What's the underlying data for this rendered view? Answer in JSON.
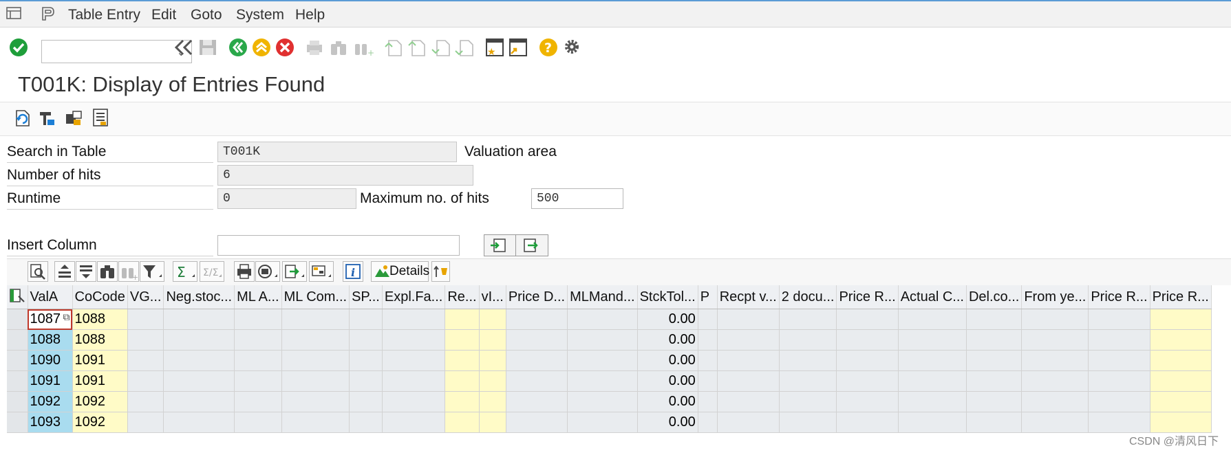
{
  "menu": {
    "items": [
      "Table Entry",
      "Edit",
      "Goto",
      "System",
      "Help"
    ]
  },
  "toolbar": {
    "command_field": ""
  },
  "title": "T001K: Display of Entries Found",
  "form": {
    "search_label": "Search in Table",
    "search_value": "T001K",
    "search_desc": "Valuation area",
    "hits_label": "Number of hits",
    "hits_value": "6",
    "runtime_label": "Runtime",
    "runtime_value": "0",
    "max_label": "Maximum no. of hits",
    "max_value": "500",
    "insert_label": "Insert Column",
    "insert_value": ""
  },
  "grid_toolbar": {
    "details_label": "Details"
  },
  "grid": {
    "columns": [
      "ValA",
      "CoCode",
      "VG...",
      "Neg.stoc...",
      "ML A...",
      "ML Com...",
      "SP...",
      "Expl.Fa...",
      "Re...",
      "vI...",
      "Price D...",
      "MLMand...",
      "StckTol...",
      "P",
      "Recpt v...",
      "2 docu...",
      "Price R...",
      "Actual C...",
      "Del.co...",
      "From ye...",
      "Price R...",
      "Price R..."
    ],
    "rows": [
      [
        "1087",
        "1088",
        "0.00"
      ],
      [
        "1088",
        "1088",
        "0.00"
      ],
      [
        "1090",
        "1091",
        "0.00"
      ],
      [
        "1091",
        "1091",
        "0.00"
      ],
      [
        "1092",
        "1092",
        "0.00"
      ],
      [
        "1093",
        "1092",
        "0.00"
      ]
    ]
  },
  "watermark": "CSDN @清风日下",
  "colors": {
    "key_column": "#a9dcef",
    "yellow_column": "#fffbc7",
    "ok_green": "#1e9e3a",
    "nav_green": "#2aa84a",
    "cancel_red": "#e03030",
    "help_yellow": "#f0b400"
  }
}
